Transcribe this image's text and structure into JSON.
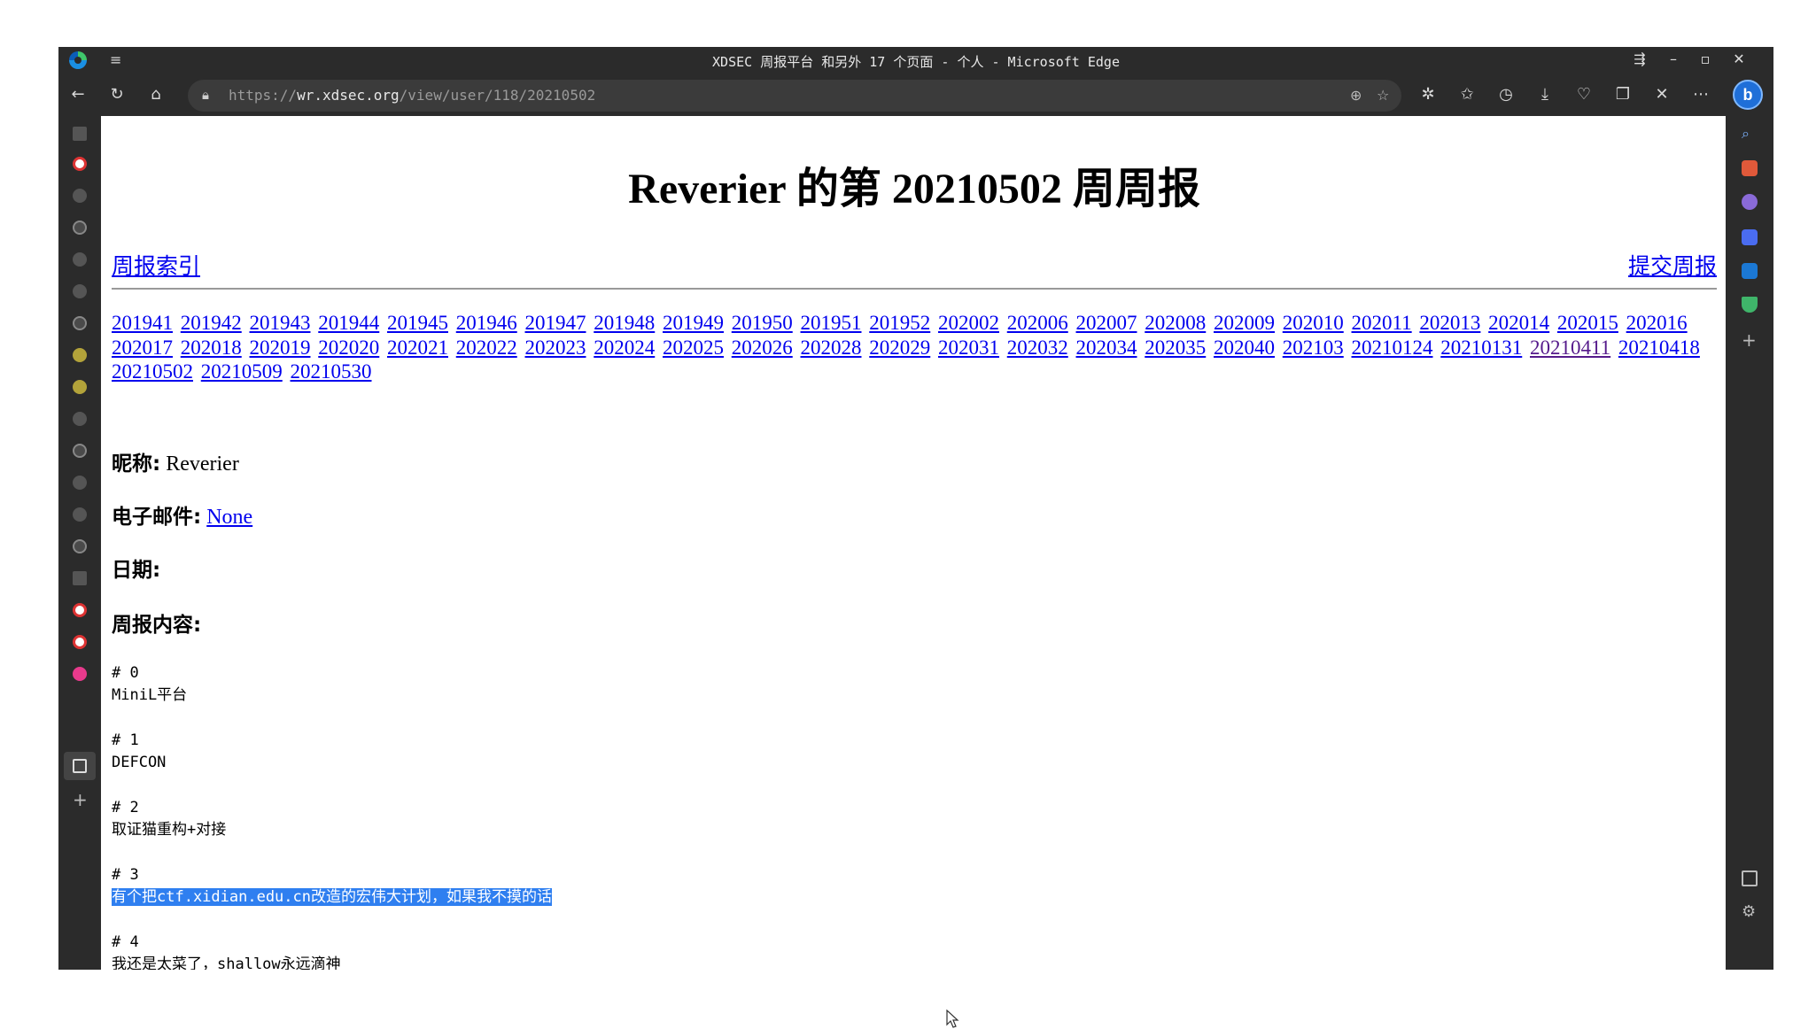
{
  "window": {
    "title": "XDSEC 周报平台 和另外 17 个页面 - 个人 - Microsoft Edge"
  },
  "address_bar": {
    "url_scheme": "https://",
    "url_host": "wr.xdsec.org",
    "url_path": "/view/user/118/20210502"
  },
  "profile": {
    "letter": "b"
  },
  "page": {
    "heading": "Reverier 的第 20210502 周周报",
    "index_link": "周报索引",
    "submit_link": "提交周报",
    "weeks": [
      "201941",
      "201942",
      "201943",
      "201944",
      "201945",
      "201946",
      "201947",
      "201948",
      "201949",
      "201950",
      "201951",
      "201952",
      "202002",
      "202006",
      "202007",
      "202008",
      "202009",
      "202010",
      "202011",
      "202013",
      "202014",
      "202015",
      "202016",
      "202017",
      "202018",
      "202019",
      "202020",
      "202021",
      "202022",
      "202023",
      "202024",
      "202025",
      "202026",
      "202028",
      "202029",
      "202031",
      "202032",
      "202034",
      "202035",
      "202040",
      "202103",
      "20210124",
      "20210131",
      "20210411",
      "20210418",
      "20210502",
      "20210509",
      "20210530"
    ],
    "visited_week": "20210411",
    "nickname_label": "昵称:",
    "nickname_value": "Reverier",
    "email_label": "电子邮件:",
    "email_value": "None",
    "date_label": "日期:",
    "report_label": "周报内容:",
    "report_items": [
      {
        "num": "# 0",
        "text": "MiniL平台"
      },
      {
        "num": "# 1",
        "text": "DEFCON"
      },
      {
        "num": "# 2",
        "text": "取证猫重构+对接"
      },
      {
        "num": "# 3",
        "text": "有个把ctf.xidian.edu.cn改造的宏伟大计划，如果我不摸的话"
      },
      {
        "num": "# 4",
        "text": "我还是太菜了，shallow永远滴神"
      }
    ]
  },
  "colors": {
    "chrome_bg": "#2b2b2b",
    "link": "#0000ee",
    "visited": "#551a8b",
    "selection": "#2f7ff0"
  }
}
